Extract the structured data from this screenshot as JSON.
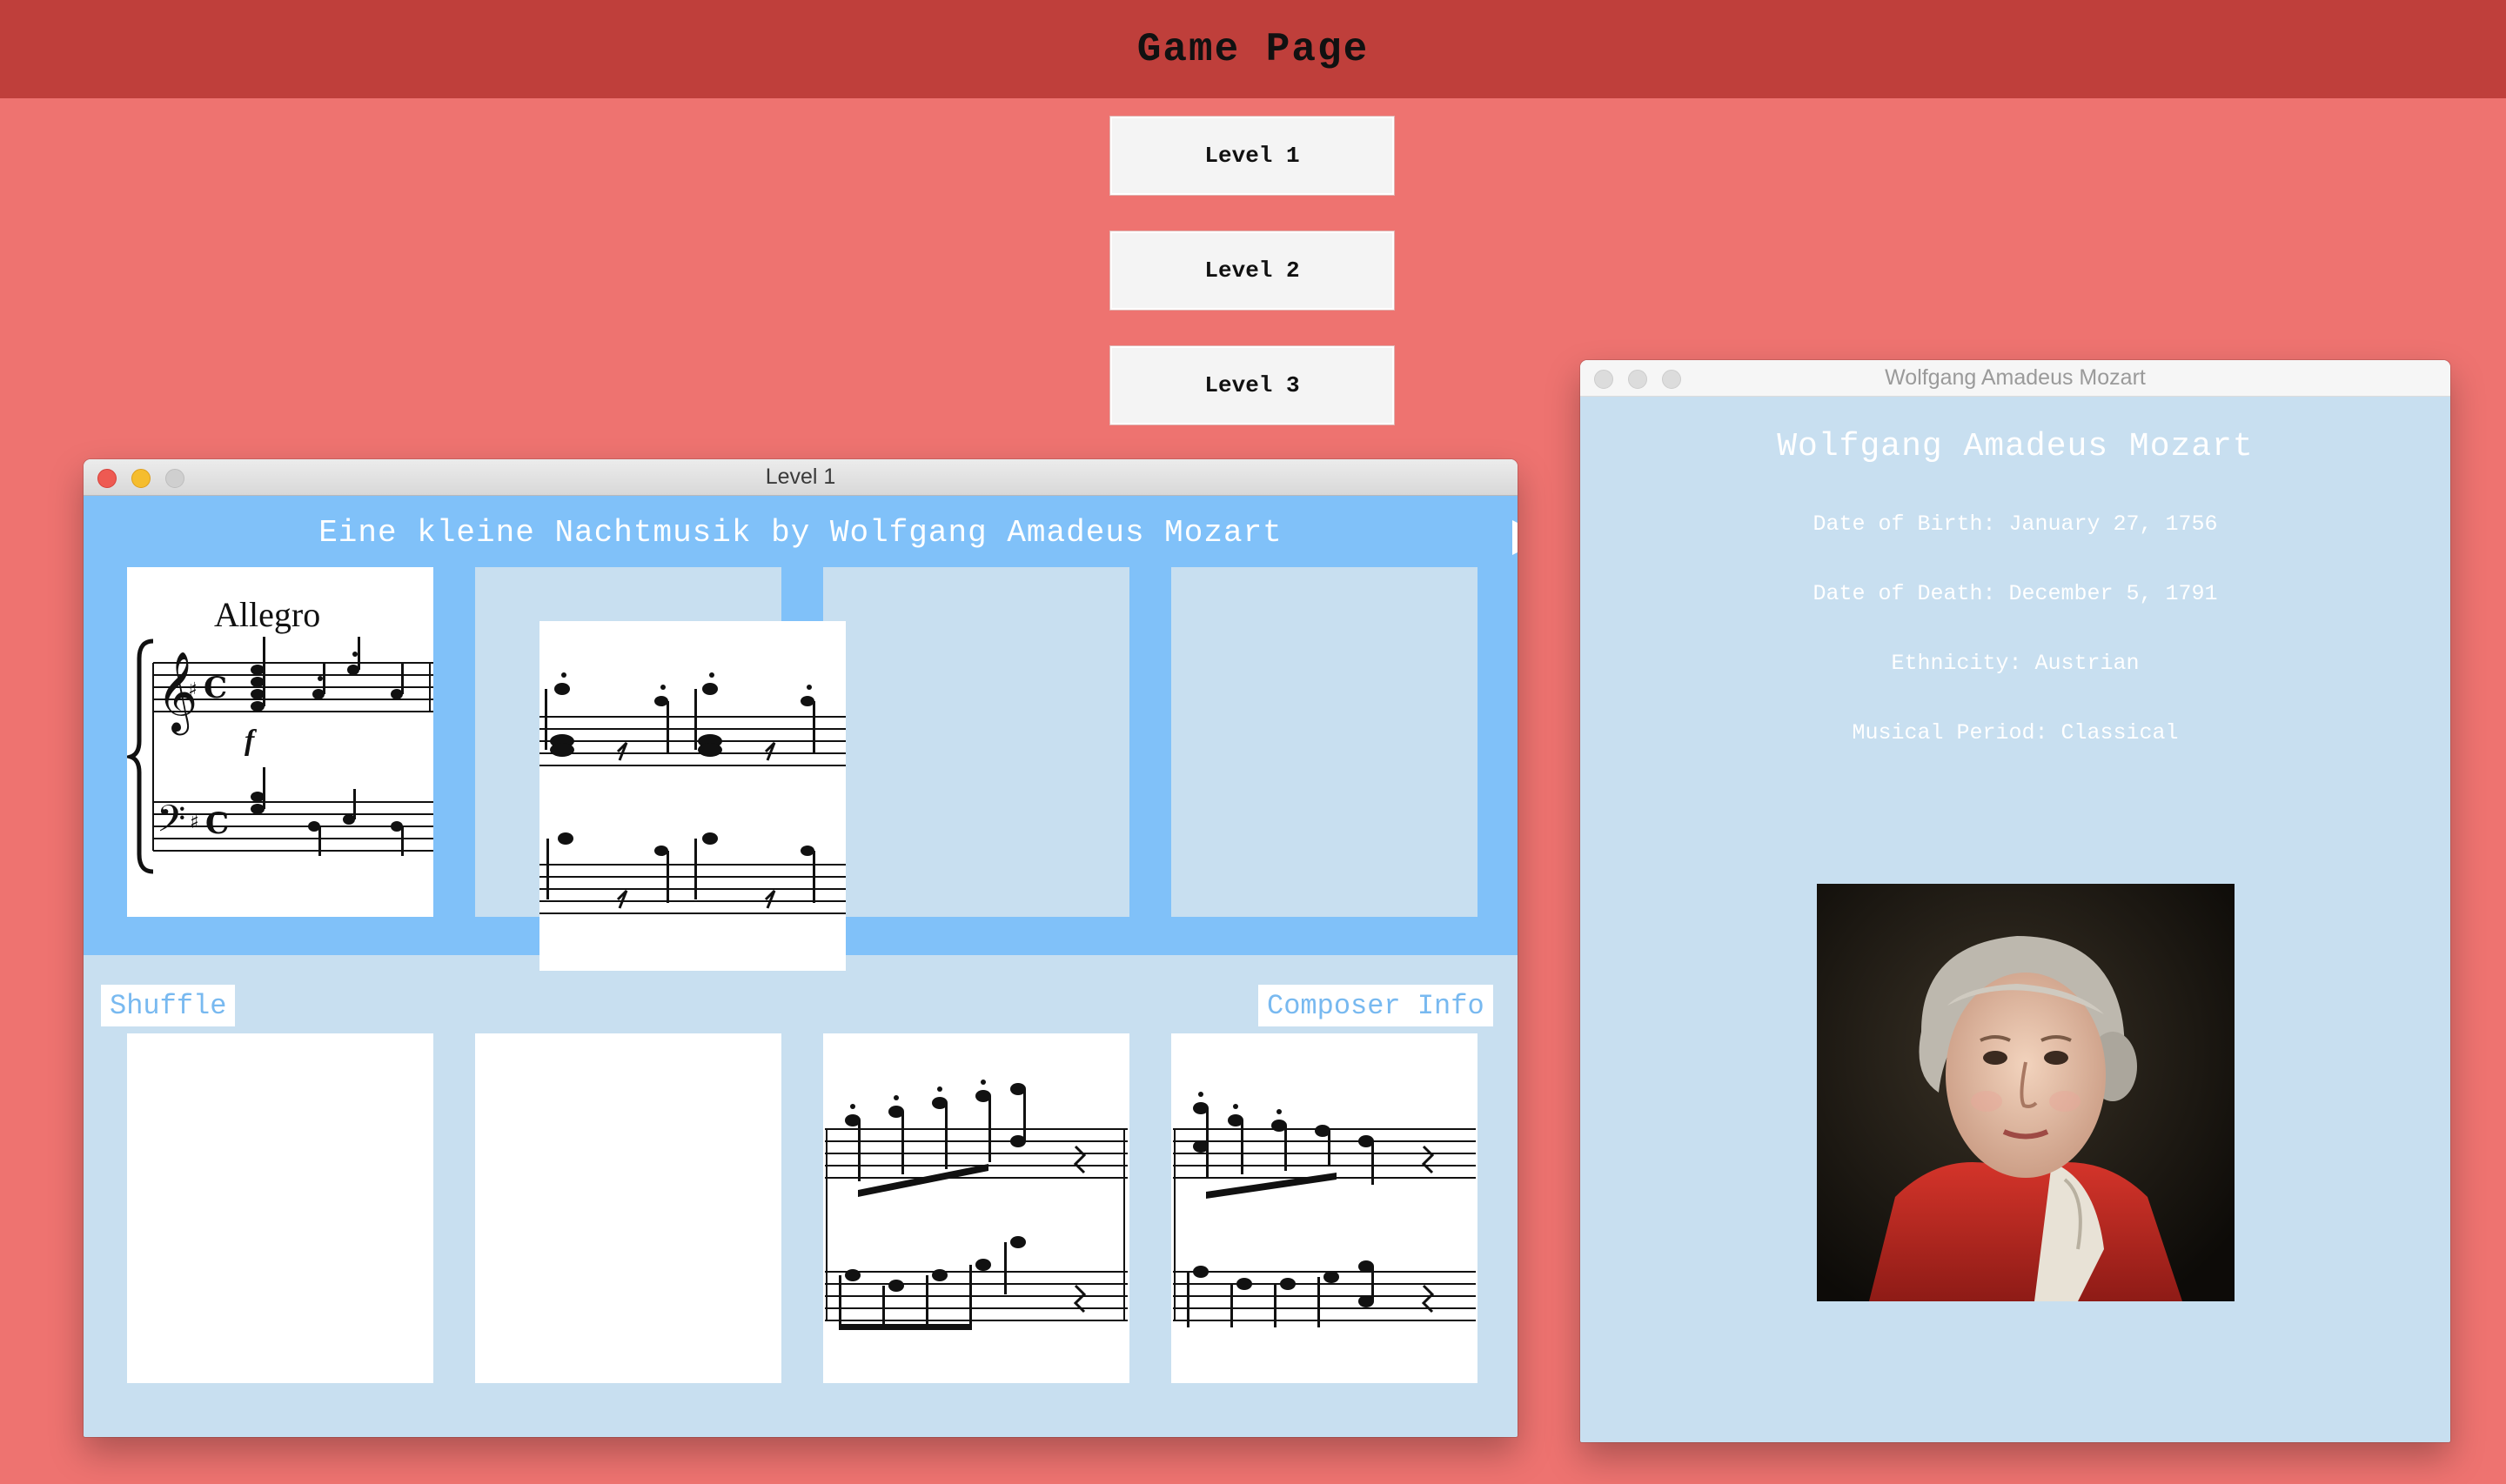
{
  "header": {
    "title": "Game Page"
  },
  "levels": [
    "Level 1",
    "Level 2",
    "Level 3"
  ],
  "level_window": {
    "title": "Level 1",
    "song_title": "Eine kleine Nachtmusik by Wolfgang Amadeus Mozart",
    "tempo_marking": "Allegro",
    "dynamic_marking": "f",
    "shuffle_label": "Shuffle",
    "composer_info_label": "Composer Info"
  },
  "composer_window": {
    "title": "Wolfgang Amadeus Mozart",
    "name": "Wolfgang Amadeus Mozart",
    "birth": "Date of Birth: January 27, 1756",
    "death": "Date of Death: December 5, 1791",
    "ethnicity": "Ethnicity: Austrian",
    "period": "Musical Period: Classical"
  },
  "colors": {
    "page_bg": "#ee7370",
    "header_bg": "#bf3f3b",
    "band_blue": "#80c1f9",
    "panel_blue": "#c8dff0",
    "accent_text": "#78b9f0"
  }
}
